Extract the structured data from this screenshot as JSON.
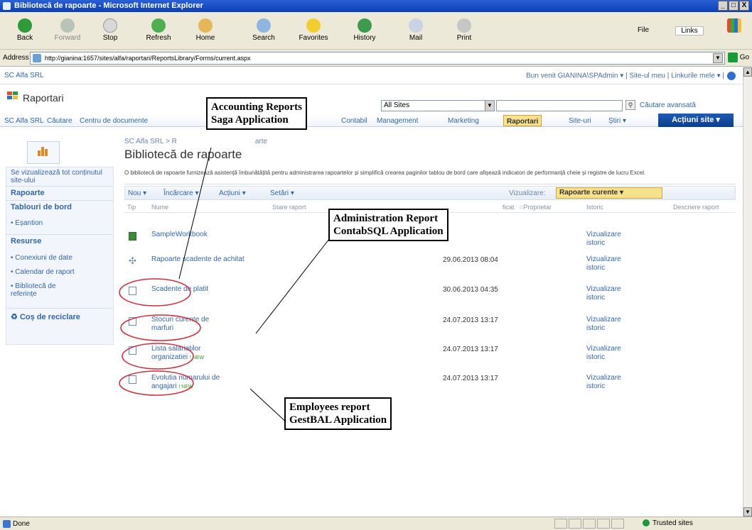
{
  "window": {
    "title": "Bibliotecă de rapoarte - Microsoft Internet Explorer",
    "buttons": [
      "_",
      "□",
      "X"
    ]
  },
  "toolbar": {
    "back": "Back",
    "forward": "Forward",
    "stop": "Stop",
    "refresh": "Refresh",
    "home": "Home",
    "search": "Search",
    "favorites": "Favorites",
    "history": "History",
    "mail": "Mail",
    "print": "Print",
    "file": "File",
    "links": "Links"
  },
  "address": {
    "label": "Address",
    "url": "http://gianina:1657/sites/alfa/raportari/ReportsLibrary/Forms/current.aspx",
    "go": "Go"
  },
  "header": {
    "site_small": "SC Alfa SRL",
    "welcome": "Bun venit GIANINA\\SPAdmin ▾  |  Site-ul meu  |  Linkurile mele ▾  |",
    "site_name": "Raportari",
    "scope": "All Sites",
    "advanced_search": "Căutare avansată"
  },
  "topnav": {
    "items": [
      "SC Alfa SRL",
      "Căutare",
      "Centru de documente",
      "Contabil",
      "Management",
      "Marketing",
      "Raportari",
      "Site-uri",
      "Știri ▾"
    ],
    "actions": "Acțiuni site ▾"
  },
  "breadcrumb": "SC Alfa SRL > R",
  "breadcrumb_tail": "arte",
  "page_title": "Bibliotecă de rapoarte",
  "leftnav": {
    "view_all": "Se vizualizează tot conținutul site-ului",
    "reports": "Rapoarte",
    "dashboards": "Tablouri de bord",
    "sample": "Eșantion",
    "resources": "Resurse",
    "data_connections": "Conexiuni de date",
    "report_calendar": "Calendar de raport",
    "reference_library": "Bibliotecă de referințe",
    "recycle_bin": "Coș de reciclare"
  },
  "description": "O bibliotecă de rapoarte furnizează asistență îmbunătățită pentru administrarea rapoartelor și simplifică crearea paginilor tablou de bord care afișează indicatori de performanță cheie și registre de lucru Excel.",
  "list_toolbar": {
    "new": "Nou ▾",
    "upload": "Încărcare ▾",
    "actions": "Acțiuni ▾",
    "settings": "Setări ▾",
    "view_label": "Vizualizare:",
    "view": "Rapoarte curente ▾"
  },
  "columns": {
    "type": "Tip",
    "name": "Nume",
    "status": "Stare raport",
    "official": "ficat",
    "owner": "Proprietar",
    "history": "Istoric",
    "description": "Descriere raport"
  },
  "rows": [
    {
      "name": "SampleWorkbook",
      "date": "",
      "history": "Vizualizare istoric",
      "icon": "workbook-icon",
      "is_new": ""
    },
    {
      "name": "Rapoarte scadente de achitat",
      "date": "29.06.2013 08:04",
      "history": "Vizualizare istoric",
      "icon": "dashboard-icon",
      "is_new": ""
    },
    {
      "name": "Scadente de platit",
      "date": "30.06.2013 04:35",
      "history": "Vizualizare istoric",
      "icon": "document-icon",
      "is_new": ""
    },
    {
      "name": "Stocuri curente de marfuri",
      "date": "24.07.2013 13:17",
      "history": "Vizualizare istoric",
      "icon": "document-icon",
      "is_new": ""
    },
    {
      "name": "Lista salariatilor organizatiei",
      "date": "24.07.2013 13:17",
      "history": "Vizualizare istoric",
      "icon": "document-icon",
      "is_new": "! NEW"
    },
    {
      "name": "Evolutia numarului de angajari",
      "date": "24.07.2013 13:17",
      "history": "Vizualizare istoric",
      "icon": "document-icon",
      "is_new": "! NEW"
    }
  ],
  "callouts": {
    "accounting": [
      "Accounting Reports",
      "Saga Application"
    ],
    "administration": [
      "Administration Report",
      "ContabSQL Application"
    ],
    "employees": [
      "Employees report",
      "GestBAL Application"
    ]
  },
  "status": {
    "text": "Done",
    "zone": "Trusted sites"
  }
}
